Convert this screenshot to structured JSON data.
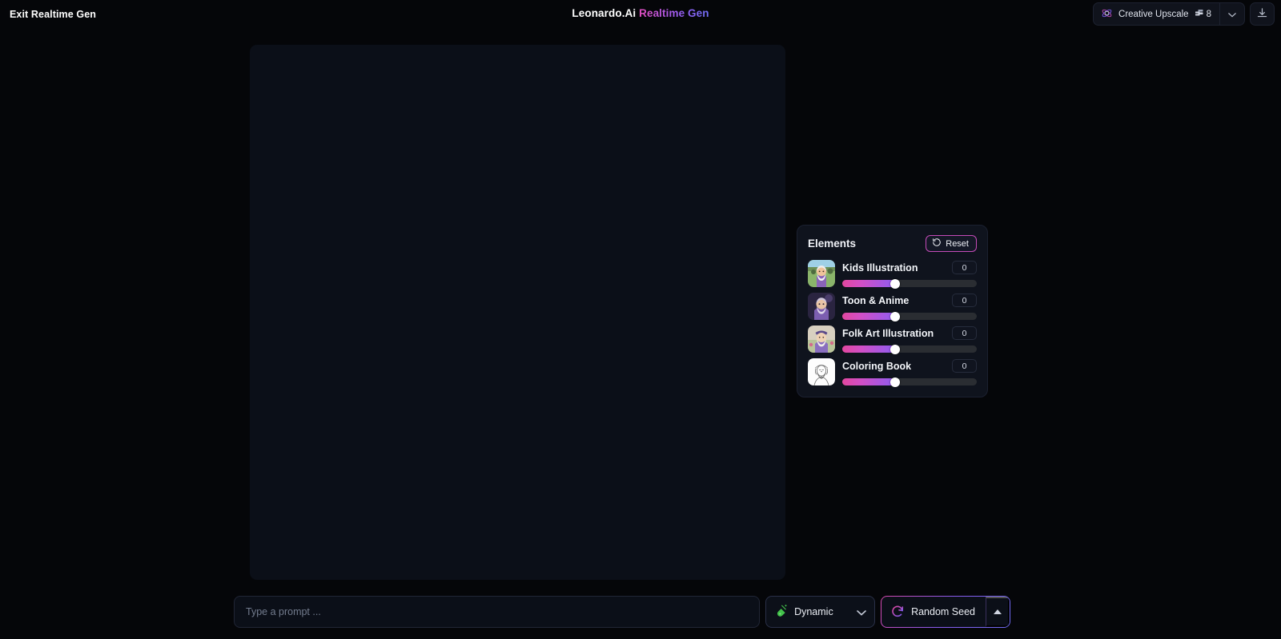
{
  "header": {
    "exit_label": "Exit Realtime Gen",
    "title_main": "Leonardo.Ai",
    "title_sub": "Realtime Gen",
    "upscale_label": "Creative Upscale",
    "token_count": "8",
    "icons": {
      "upscale": "atom-icon",
      "token": "token-icon",
      "caret": "chevron-down-icon",
      "download": "download-icon"
    }
  },
  "canvas": {
    "name": "generation-canvas",
    "state": "empty"
  },
  "elements_panel": {
    "title": "Elements",
    "reset_label": "Reset",
    "reset_icon": "reset-icon",
    "items": [
      {
        "name": "Kids Illustration",
        "value": "0",
        "thumb": "wizard-green-thumb"
      },
      {
        "name": "Toon & Anime",
        "value": "0",
        "thumb": "wizard-purple-thumb"
      },
      {
        "name": "Folk Art Illustration",
        "value": "0",
        "thumb": "wizard-folk-thumb"
      },
      {
        "name": "Coloring Book",
        "value": "0",
        "thumb": "lineart-white-thumb"
      }
    ]
  },
  "bottom_bar": {
    "prompt_placeholder": "Type a prompt ...",
    "prompt_value": "",
    "preset_label": "Dynamic",
    "preset_icon": "flask-icon",
    "preset_caret": "chevron-down-icon",
    "seed_label": "Random Seed",
    "seed_icon": "refresh-icon",
    "seed_caret": "chevron-up-icon"
  },
  "colors": {
    "page_bg": "#050609",
    "canvas_bg": "#0b0f18",
    "panel_bg": "#0f131d",
    "accent_pink": "#e2479f",
    "accent_purple": "#8a5cf0",
    "accent_green": "#43c24b"
  }
}
